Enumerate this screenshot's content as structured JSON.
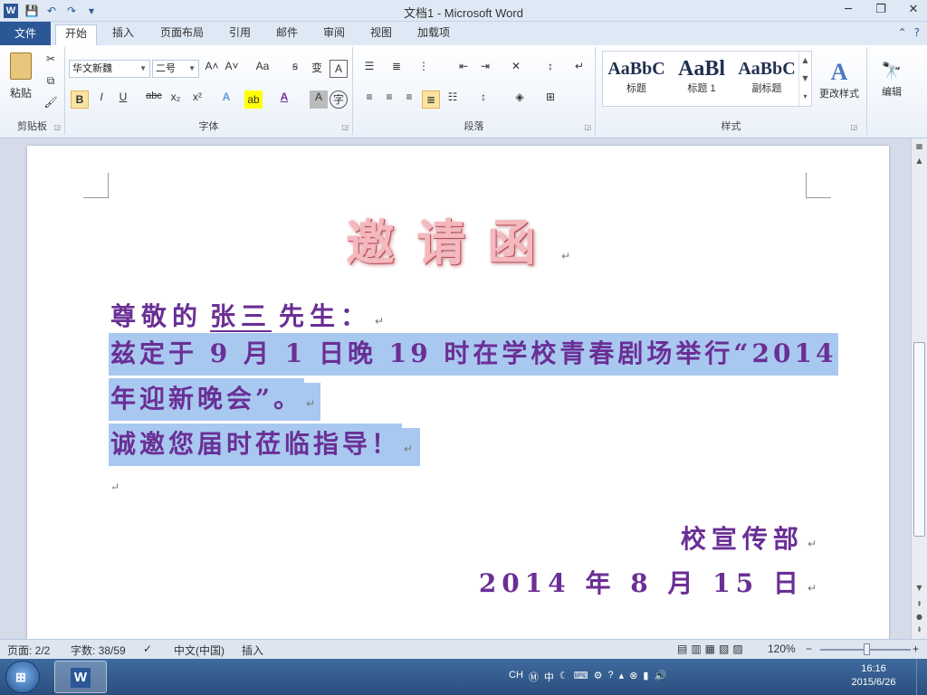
{
  "window": {
    "title": "文档1 - Microsoft Word",
    "app_icon": "W",
    "minimize": "─",
    "restore": "❐",
    "close": "✕"
  },
  "qat": {
    "save": "💾",
    "undo": "↶",
    "redo": "↷",
    "customize": "▾"
  },
  "tabs": [
    {
      "label": "文件"
    },
    {
      "label": "开始"
    },
    {
      "label": "插入"
    },
    {
      "label": "页面布局"
    },
    {
      "label": "引用"
    },
    {
      "label": "邮件"
    },
    {
      "label": "审阅"
    },
    {
      "label": "视图"
    },
    {
      "label": "加载项"
    }
  ],
  "ribbon": {
    "clipboard": {
      "paste_label": "粘贴",
      "group_label": "剪贴板"
    },
    "font": {
      "font_name": "华文新魏",
      "font_size": "二号",
      "group_label": "字体",
      "grow": "A˄",
      "shrink": "A˅",
      "change_case": "Aa",
      "bold": "B",
      "italic": "I",
      "underline": "U",
      "strike": "abc",
      "subscript": "x₂",
      "superscript": "x²",
      "clear": "A",
      "char_border": "A"
    },
    "paragraph": {
      "group_label": "段落"
    },
    "styles": {
      "group_label": "样式",
      "items": [
        {
          "sample": "AaBbC",
          "name": "标题"
        },
        {
          "sample": "AaBl",
          "name": "标题 1"
        },
        {
          "sample": "AaBbC",
          "name": "副标题"
        }
      ],
      "change_styles": "更改样式"
    },
    "editing": {
      "label": "编辑"
    }
  },
  "document": {
    "heading": "邀请函",
    "para_mark": "↵",
    "salutation_prefix": "尊敬的",
    "salutation_name": "张三",
    "salutation_suffix": "先生：",
    "body_line1": "兹定于 9 月 1 日晚 19 时在学校青春剧场举行“2014",
    "body_line2": "年迎新晚会”。",
    "body_line3": "诚邀您届时莅临指导！",
    "signature_org": "校宣传部",
    "signature_date": "2014 年 8 月 15 日"
  },
  "statusbar": {
    "page": "页面: 2/2",
    "words": "字数: 38/59",
    "language": "中文(中国)",
    "mode": "插入",
    "zoom": "120%",
    "zoom_out": "−",
    "zoom_in": "+"
  },
  "taskbar": {
    "input_method": "CH",
    "time": "16:16",
    "date": "2015/6/26"
  }
}
